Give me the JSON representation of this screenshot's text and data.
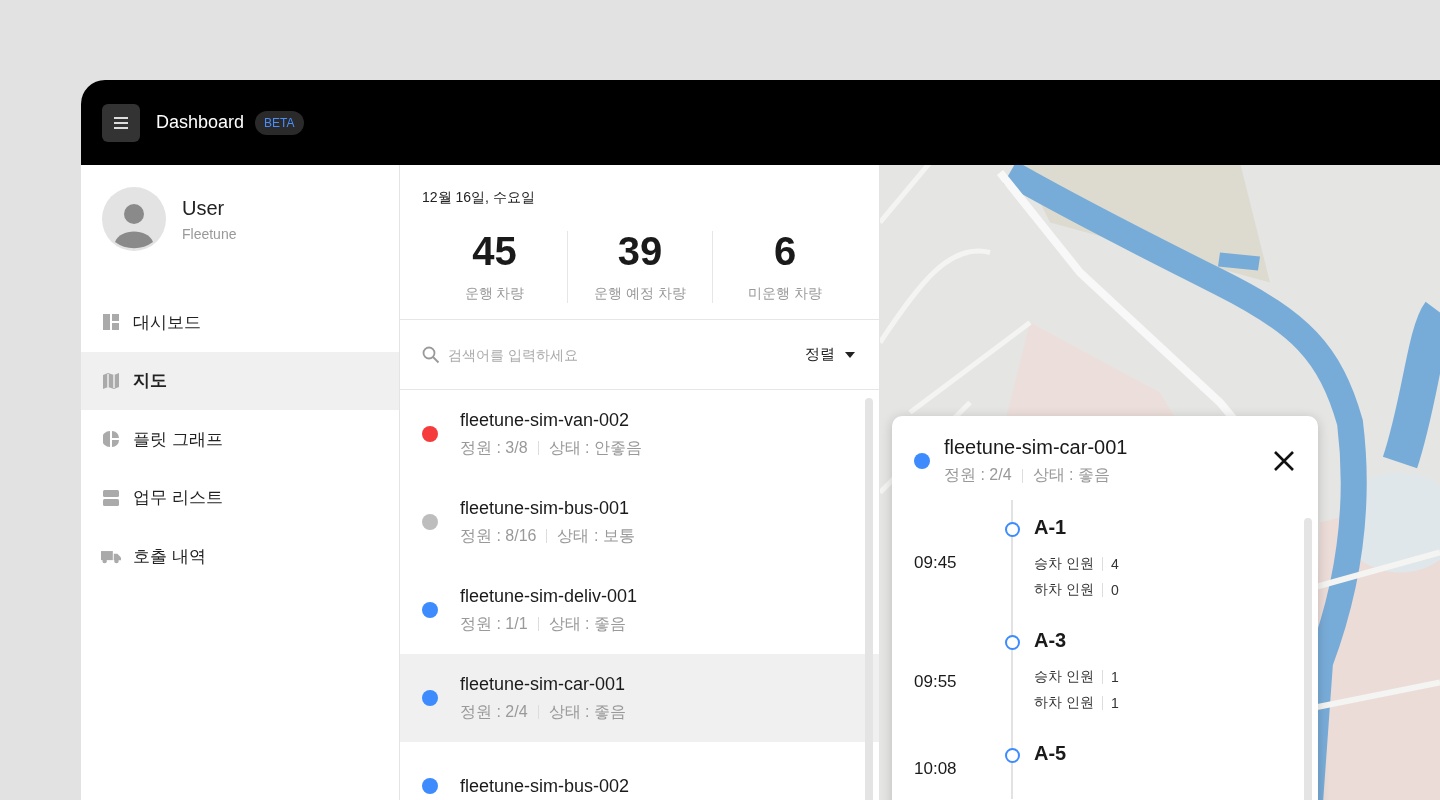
{
  "header": {
    "title": "Dashboard",
    "badge": "BETA"
  },
  "user": {
    "name": "User",
    "organization": "Fleetune"
  },
  "nav": [
    {
      "label": "대시보드",
      "selected": false
    },
    {
      "label": "지도",
      "selected": true
    },
    {
      "label": "플릿 그래프",
      "selected": false
    },
    {
      "label": "업무 리스트",
      "selected": false
    },
    {
      "label": "호출 내역",
      "selected": false
    }
  ],
  "summary": {
    "date": "12월 16일, 수요일",
    "stats": [
      {
        "value": "45",
        "label": "운행 차량"
      },
      {
        "value": "39",
        "label": "운행 예정 차량"
      },
      {
        "value": "6",
        "label": "미운행 차량"
      }
    ]
  },
  "search": {
    "placeholder": "검색어를 입력하세요",
    "sort": "정렬"
  },
  "vehicles": [
    {
      "name": "fleetune-sim-van-002",
      "capacity": "정원 : 3/8",
      "status": "상태 : 안좋음",
      "color": "#f53b3b",
      "selected": false
    },
    {
      "name": "fleetune-sim-bus-001",
      "capacity": "정원 : 8/16",
      "status": "상태 : 보통",
      "color": "#bdbdbd",
      "selected": false
    },
    {
      "name": "fleetune-sim-deliv-001",
      "capacity": "정원 : 1/1",
      "status": "상태 : 좋음",
      "color": "#3d8bfd",
      "selected": false
    },
    {
      "name": "fleetune-sim-car-001",
      "capacity": "정원 : 2/4",
      "status": "상태 : 좋음",
      "color": "#3d8bfd",
      "selected": true
    },
    {
      "name": "fleetune-sim-bus-002",
      "color": "#3d8bfd",
      "selected": false
    }
  ],
  "detail": {
    "name": "fleetune-sim-car-001",
    "capacity": "정원 : 2/4",
    "status": "상태 : 좋음",
    "color": "#3d8bfd",
    "stops": [
      {
        "time": "09:45",
        "name": "A-1",
        "rows": [
          {
            "label": "승차 인원",
            "value": "4"
          },
          {
            "label": "하차 인원",
            "value": "0"
          }
        ]
      },
      {
        "time": "09:55",
        "name": "A-3",
        "rows": [
          {
            "label": "승차 인원",
            "value": "1"
          },
          {
            "label": "하차 인원",
            "value": "1"
          }
        ]
      },
      {
        "time": "10:08",
        "name": "A-5"
      }
    ]
  }
}
